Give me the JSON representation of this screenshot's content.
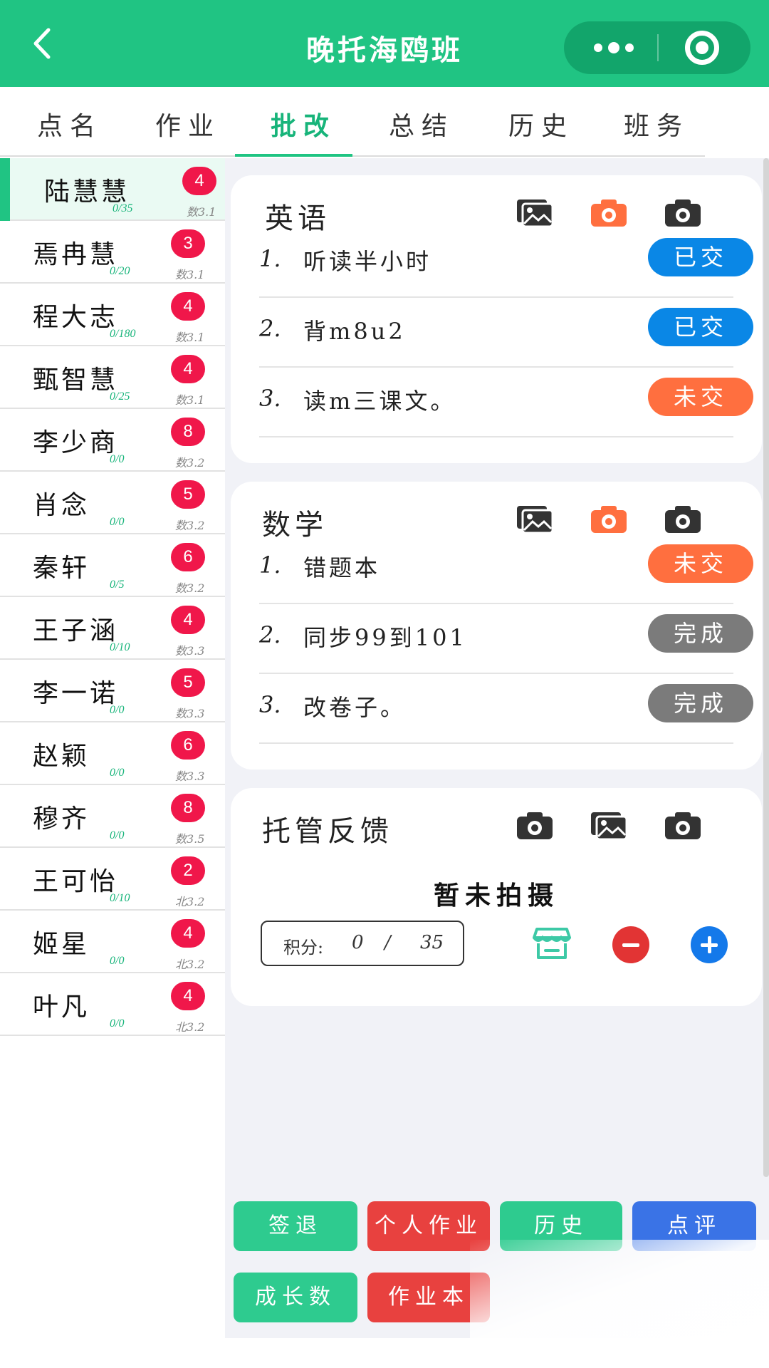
{
  "header": {
    "title": "晚托海鸥班"
  },
  "tabs": [
    "点名",
    "作业",
    "批改",
    "总结",
    "历史",
    "班务"
  ],
  "active_tab": "批改",
  "students": [
    {
      "name": "陆慧慧",
      "badge": "4",
      "score": "0/35",
      "grade": "数3.1",
      "active": true
    },
    {
      "name": "焉冉慧",
      "badge": "3",
      "score": "0/20",
      "grade": "数3.1"
    },
    {
      "name": "程大志",
      "badge": "4",
      "score": "0/180",
      "grade": "数3.1"
    },
    {
      "name": "甄智慧",
      "badge": "4",
      "score": "0/25",
      "grade": "数3.1"
    },
    {
      "name": "李少商",
      "badge": "8",
      "score": "0/0",
      "grade": "数3.2"
    },
    {
      "name": "肖念",
      "badge": "5",
      "score": "0/0",
      "grade": "数3.2"
    },
    {
      "name": "秦轩",
      "badge": "6",
      "score": "0/5",
      "grade": "数3.2"
    },
    {
      "name": "王子涵",
      "badge": "4",
      "score": "0/10",
      "grade": "数3.3"
    },
    {
      "name": "李一诺",
      "badge": "5",
      "score": "0/0",
      "grade": "数3.3"
    },
    {
      "name": "赵颖",
      "badge": "6",
      "score": "0/0",
      "grade": "数3.3"
    },
    {
      "name": "穆齐",
      "badge": "8",
      "score": "0/0",
      "grade": "数3.5"
    },
    {
      "name": "王可怡",
      "badge": "2",
      "score": "0/10",
      "grade": "北3.2"
    },
    {
      "name": "姬星",
      "badge": "4",
      "score": "0/0",
      "grade": "北3.2"
    },
    {
      "name": "叶凡",
      "badge": "4",
      "score": "0/0",
      "grade": "北3.2"
    }
  ],
  "english": {
    "title": "英语",
    "items": [
      {
        "num": "1.",
        "text": "听读半小时",
        "status": "已交"
      },
      {
        "num": "2.",
        "text": "背m8u2",
        "status": "已交"
      },
      {
        "num": "3.",
        "text": "读m三课文。",
        "status": "未交"
      }
    ]
  },
  "math": {
    "title": "数学",
    "items": [
      {
        "num": "1.",
        "text": "错题本",
        "status": "未交"
      },
      {
        "num": "2.",
        "text": "同步99到101",
        "status": "完成"
      },
      {
        "num": "3.",
        "text": "改卷子。",
        "status": "完成"
      }
    ]
  },
  "feedback": {
    "title": "托管反馈",
    "empty_text": "暂未拍摄",
    "points_label": "积分:",
    "points_current": "0",
    "points_sep": "/",
    "points_total": "35"
  },
  "actions": {
    "sign_out": "签退",
    "personal_homework": "个人作业",
    "history": "历史",
    "comment": "点评",
    "growth": "成长数",
    "homework_book": "作业本"
  },
  "colors": {
    "brand": "#20c483",
    "submitted": "#0a87e6",
    "missing": "#ff6f3f",
    "done": "#7b7b7b",
    "badge": "#f0174a"
  },
  "icons": [
    "back-arrow-icon",
    "more-dots-icon",
    "target-icon",
    "image-icon",
    "camera-icon",
    "store-icon",
    "minus-icon",
    "plus-icon"
  ]
}
